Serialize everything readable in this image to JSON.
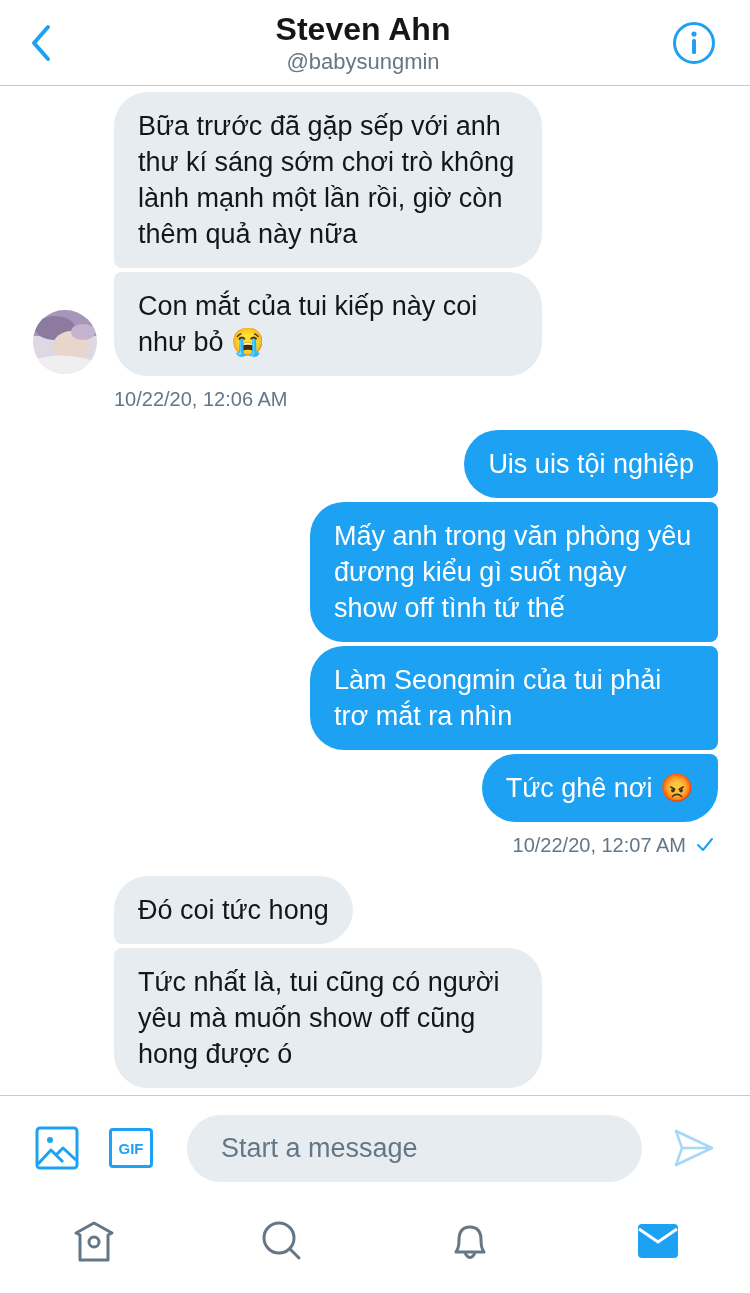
{
  "header": {
    "title": "Steven Ahn",
    "handle": "@babysungmin"
  },
  "groups": [
    {
      "kind": "received",
      "delivered": false,
      "avatar": {
        "kind": "picture"
      },
      "messages": [
        "Bữa trước đã gặp sếp với anh thư kí sáng sớm chơi trò không lành mạnh một lần rồi, giờ còn thêm quả này nữa",
        "Con mắt của tui kiếp này coi như bỏ 😭"
      ],
      "timestamp": "10/22/20, 12:06 AM"
    },
    {
      "kind": "sent",
      "delivered": true,
      "messages": [
        "Uis uis tội nghiệp",
        "Mấy anh trong văn phòng yêu đương kiểu gì suốt ngày show off tình tứ thế",
        "Làm Seongmin của tui phải trơ mắt ra nhìn",
        "Tức ghê nơi 😡"
      ],
      "timestamp": "10/22/20, 12:07 AM"
    },
    {
      "kind": "received",
      "delivered": false,
      "messages": [
        "Đó coi tức hong",
        "Tức nhất là, tui cũng có người yêu mà muốn show off cũng hong được ó"
      ]
    }
  ],
  "composer": {
    "gif_label": "GIF",
    "placeholder": "Start a message"
  },
  "tabs": [
    {
      "kind": "home",
      "selected": false
    },
    {
      "kind": "search",
      "selected": false
    },
    {
      "kind": "notifications",
      "selected": false
    },
    {
      "kind": "messages",
      "selected": true
    }
  ]
}
